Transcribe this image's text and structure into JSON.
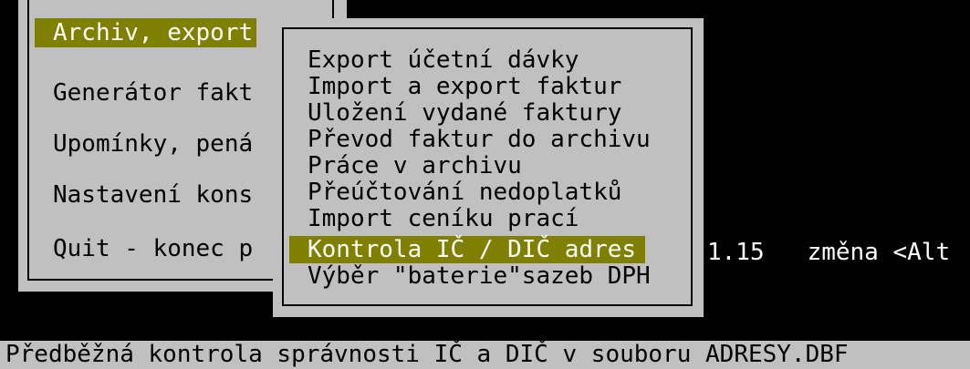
{
  "main_menu": {
    "items": [
      {
        "label": "Archiv, export",
        "selected": true
      },
      {
        "label": "Generátor fakt",
        "selected": false
      },
      {
        "label": "Upomínky, pená",
        "selected": false
      },
      {
        "label": "Nastavení kons",
        "selected": false
      },
      {
        "label": "Quit - konec p",
        "selected": false
      }
    ]
  },
  "sub_menu": {
    "items": [
      {
        "label": "Export účetní dávky",
        "selected": false
      },
      {
        "label": "Import a export faktur",
        "selected": false
      },
      {
        "label": "Uložení vydané faktury",
        "selected": false
      },
      {
        "label": "Převod faktur do archivu",
        "selected": false
      },
      {
        "label": "Práce v archivu",
        "selected": false
      },
      {
        "label": "Přeúčtování nedoplatků",
        "selected": false
      },
      {
        "label": "Import ceníku prací",
        "selected": false
      },
      {
        "label": "Kontrola IČ / DIČ adres",
        "selected": true
      },
      {
        "label": "Výběr \"baterie\"sazeb DPH",
        "selected": false
      }
    ]
  },
  "info": {
    "text": "1.15   změna <Alt"
  },
  "status_line": {
    "text": "Předběžná kontrola správnosti IČ a DIČ v souboru ADRESY.DBF"
  },
  "colors": {
    "panel_bg": "#c0c0c0",
    "highlight_bg": "#808000",
    "highlight_fg": "#ffffff",
    "screen_bg": "#000000"
  }
}
